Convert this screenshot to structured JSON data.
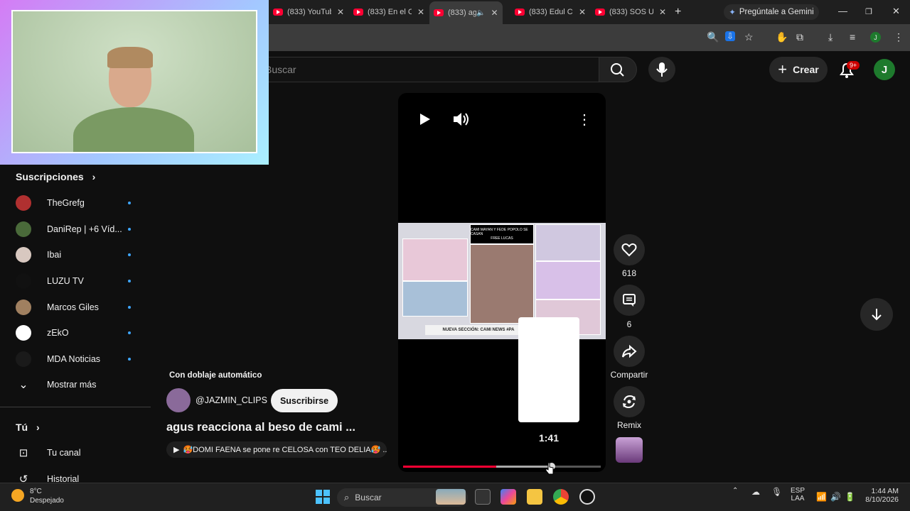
{
  "browser": {
    "tabs": [
      {
        "title": "(833) YouTube"
      },
      {
        "title": "(833) En el C"
      },
      {
        "title": "(833) ag"
      },
      {
        "title": "(833) Edul C"
      },
      {
        "title": "(833) SOS U"
      }
    ],
    "new_tab_label": "+",
    "gemini_label": "Pregúntale a Gemini",
    "profile_initial": "J"
  },
  "header": {
    "search_placeholder": "Buscar",
    "create_label": "Crear",
    "notifications_badge": "9+",
    "avatar_initial": "J"
  },
  "sidebar": {
    "subscriptions_title": "Suscripciones",
    "subscriptions": [
      {
        "name": "TheGrefg",
        "color": "#b03030"
      },
      {
        "name": "DaniRep | +6 Víd...",
        "color": "#4a6a3a"
      },
      {
        "name": "Ibai",
        "color": "#d8c8c0"
      },
      {
        "name": "LUZU TV",
        "color": "#111111"
      },
      {
        "name": "Marcos Giles",
        "color": "#a08060"
      },
      {
        "name": "zEkO",
        "color": "#ffffff"
      },
      {
        "name": "MDA Noticias",
        "color": "#1a1a1a"
      }
    ],
    "show_more": "Mostrar más",
    "you_title": "Tú",
    "your_channel": "Tu canal",
    "history": "Historial"
  },
  "short": {
    "dub_label": "Con doblaje automático",
    "channel": "@JAZMIN_CLIPS",
    "subscribe_label": "Suscribirse",
    "title": "agus reacciona al beso de cami ...",
    "audio": "🥵DOMI FAENA se pone re CELOSA con TEO DELIA🥵 ...",
    "thumb_headline": "CAMI MAYAN Y FEDE POPOLO SE CASAN",
    "thumb_sub": "FREE LUCAS",
    "thumb_caption": "NUEVA SECCIÓN: CAMI NEWS #PA",
    "preview_time": "1:41",
    "progress": 0.47,
    "buffer": 0.75
  },
  "actions": {
    "likes": "618",
    "comments": "6",
    "share": "Compartir",
    "remix": "Remix"
  },
  "taskbar": {
    "temp": "8°C",
    "weather": "Despejado",
    "search": "Buscar",
    "lang1": "ESP",
    "lang2": "LAA",
    "time": "1:44 AM",
    "date": "8/10/2026"
  }
}
